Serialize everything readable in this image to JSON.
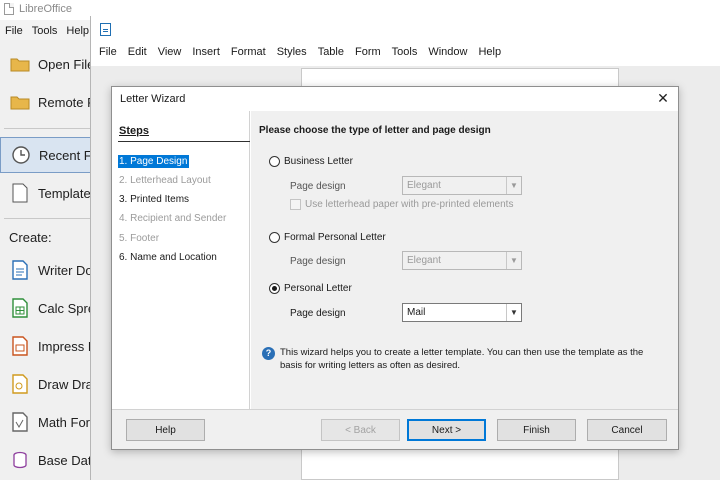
{
  "start_center": {
    "title": "LibreOffice",
    "menu": [
      "File",
      "Tools",
      "Help"
    ],
    "sidebar": {
      "open_file": "Open File",
      "remote_files": "Remote Files",
      "recent_files": "Recent Files",
      "templates": "Templates",
      "create_label": "Create:",
      "create_items": [
        "Writer Document",
        "Calc Spreadsheet",
        "Impress Presentation",
        "Draw Drawing",
        "Math Formula",
        "Base Database"
      ]
    }
  },
  "writer": {
    "menu": [
      "File",
      "Edit",
      "View",
      "Insert",
      "Format",
      "Styles",
      "Table",
      "Form",
      "Tools",
      "Window",
      "Help"
    ]
  },
  "wizard": {
    "title": "Letter Wizard",
    "close_glyph": "✕",
    "steps_header": "Steps",
    "steps": [
      "1. Page Design",
      "2. Letterhead Layout",
      "3. Printed Items",
      "4. Recipient and Sender",
      "5. Footer",
      "6. Name and Location"
    ],
    "content": {
      "heading": "Please choose the type of letter and page design",
      "business": {
        "label": "Business Letter",
        "page_design_label": "Page design",
        "page_design_value": "Elegant",
        "letterhead_label": "Use letterhead paper with pre-printed elements"
      },
      "formal": {
        "label": "Formal Personal Letter",
        "page_design_label": "Page design",
        "page_design_value": "Elegant"
      },
      "personal": {
        "label": "Personal Letter",
        "page_design_label": "Page design",
        "page_design_value": "Mail"
      },
      "selected_type": "Personal Letter",
      "info_text": "This wizard helps you to create a letter template. You can then use the template as the basis for writing letters as often as desired."
    },
    "buttons": {
      "help": "Help",
      "back": "< Back",
      "next": "Next >",
      "finish": "Finish",
      "cancel": "Cancel"
    }
  }
}
